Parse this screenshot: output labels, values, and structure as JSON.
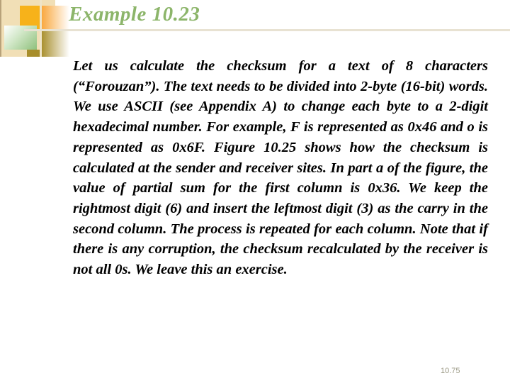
{
  "slide": {
    "title": "Example 10.23",
    "body": "Let us calculate the checksum for a text of 8 characters (“Forouzan”). The text needs to be divided into 2-byte (16-bit) words. We use ASCII (see Appendix A) to change each byte to a 2-digit hexadecimal number. For example, F is represented as 0x46 and o is represented as 0x6F. Figure 10.25 shows how the checksum is calculated at the sender and receiver sites. In part a of the figure, the value of partial sum for the first column is 0x36. We keep the rightmost digit (6) and insert the leftmost digit (3) as the carry in the second column. The process is repeated for each column. Note that if there is any corruption, the checksum recalculated by the receiver is not all 0s. We leave this an exercise.",
    "page_number": "10.75"
  },
  "colors": {
    "title": "#8cb56a",
    "body": "#000000",
    "page_number": "#9c9a86"
  }
}
